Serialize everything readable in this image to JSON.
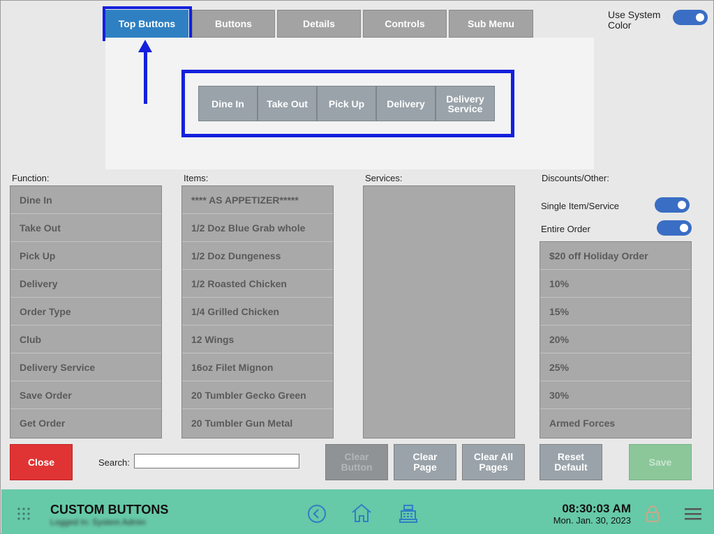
{
  "tabs": [
    {
      "label": "Top Buttons",
      "active": true
    },
    {
      "label": "Buttons"
    },
    {
      "label": "Details"
    },
    {
      "label": "Controls"
    },
    {
      "label": "Sub Menu"
    }
  ],
  "system_color": {
    "label": "Use System Color",
    "on": true
  },
  "preview_buttons": [
    "Dine In",
    "Take Out",
    "Pick Up",
    "Delivery",
    "Delivery Service"
  ],
  "sections": {
    "function": "Function:",
    "items": "Items:",
    "services": "Services:",
    "discounts": "Discounts/Other:"
  },
  "function_list": [
    "Dine In",
    "Take Out",
    "Pick Up",
    "Delivery",
    "Order Type",
    "Club",
    "Delivery Service",
    "Save Order",
    "Get Order"
  ],
  "items_list": [
    "**** AS APPETIZER*****",
    "1/2 Doz Blue Grab whole",
    "1/2 Doz Dungeness",
    "1/2 Roasted Chicken",
    "1/4 Grilled Chicken",
    "12 Wings",
    "16oz Filet Mignon",
    "20 Tumbler Gecko Green",
    "20 Tumbler Gun Metal"
  ],
  "discount_options": {
    "single": "Single Item/Service",
    "entire": "Entire Order"
  },
  "discount_list": [
    "$20 off Holiday Order",
    "10%",
    "15%",
    "20%",
    "25%",
    "30%",
    "Armed Forces"
  ],
  "buttons": {
    "close": "Close",
    "clear_button": "Clear Button",
    "clear_page": "Clear Page",
    "clear_all_pages": "Clear All Pages",
    "reset_default": "Reset Default",
    "save": "Save"
  },
  "search": {
    "label": "Search:",
    "value": ""
  },
  "footer": {
    "title": "CUSTOM BUTTONS",
    "subtitle": "Logged In: System Admin",
    "time": "08:30:03 AM",
    "date": "Mon. Jan. 30, 2023"
  },
  "colors": {
    "accent": "#2f80c2",
    "highlight": "#1420dc",
    "close": "#e03434",
    "save": "#8cc79a",
    "footer": "#66c9a8",
    "toggle": "#3a6ec4"
  }
}
